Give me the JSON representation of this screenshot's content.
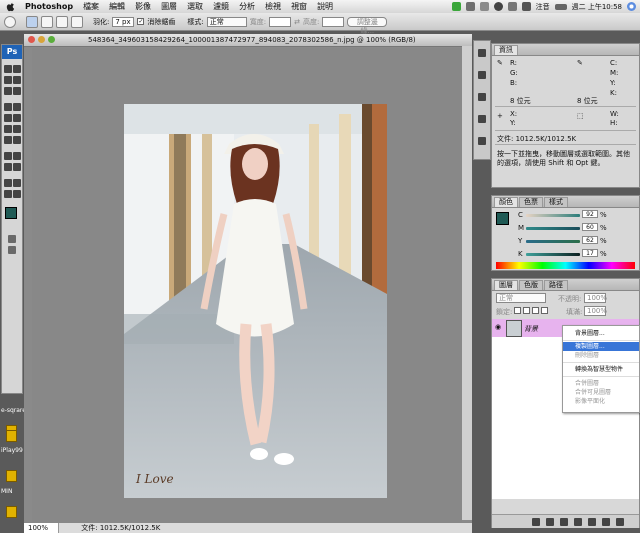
{
  "menubar": {
    "app_name": "Photoshop",
    "items": [
      "檔案",
      "編輯",
      "影像",
      "圖層",
      "選取",
      "濾鏡",
      "分析",
      "檢視",
      "視窗",
      "說明"
    ],
    "input_method": "注音",
    "clock": "週二 上午10:58"
  },
  "options_bar": {
    "feather_label": "羽化:",
    "feather_value": "7 px",
    "antialias_label": "消除鋸齒",
    "style_label": "樣式:",
    "style_value": "正常",
    "width_label": "寬度:",
    "height_label": "高度:",
    "refine_label": "調整邊緣..."
  },
  "toolbox": {
    "logo": "Ps"
  },
  "document": {
    "title": "548364_349603158429264_100001387472977_894083_2078302586_n.jpg @ 100% (RGB/8)",
    "zoom": "100%",
    "file_info": "文件: 1012.5K/1012.5K",
    "signature": "I Love"
  },
  "info_panel": {
    "tabs": [
      "資訊"
    ],
    "r": "R:",
    "g": "G:",
    "b": "B:",
    "c": "C:",
    "m": "M:",
    "y": "Y:",
    "k": "K:",
    "bit_left": "8 位元",
    "bit_right": "8 位元",
    "x": "X:",
    "y2": "Y:",
    "w": "W:",
    "h": "H:",
    "file_info": "文件: 1012.5K/1012.5K",
    "hint": "按一下並拖曳，移動圖層或選取範圍。其他的選項，請使用 Shift 和 Opt 鍵。"
  },
  "color_panel": {
    "tabs": [
      "顏色",
      "色票",
      "樣式"
    ],
    "channels": [
      {
        "label": "C",
        "value": "92",
        "unit": "%"
      },
      {
        "label": "M",
        "value": "60",
        "unit": "%"
      },
      {
        "label": "Y",
        "value": "62",
        "unit": "%"
      },
      {
        "label": "K",
        "value": "17",
        "unit": "%"
      }
    ]
  },
  "layers_panel": {
    "tabs": [
      "圖層",
      "色版",
      "路徑"
    ],
    "blend_mode": "正常",
    "opacity_label": "不透明:",
    "opacity_value": "100%",
    "lock_label": "鎖定:",
    "fill_label": "填滿:",
    "fill_value": "100%",
    "layer_name": "背景"
  },
  "context_menu": {
    "items": [
      {
        "label": "背景圖層...",
        "state": "normal"
      },
      {
        "label": "複製圖層...",
        "state": "highlight"
      },
      {
        "label": "刪除圖層",
        "state": "disabled"
      },
      {
        "label": "轉換為智慧型物件",
        "state": "normal"
      },
      {
        "label": "合併圖層",
        "state": "disabled"
      },
      {
        "label": "合併可見圖層",
        "state": "disabled"
      },
      {
        "label": "影像平面化",
        "state": "disabled"
      }
    ]
  },
  "desktop": {
    "labels": [
      "e-sqrare",
      "iPlay99",
      "MIN"
    ]
  },
  "colors": {
    "foreground": "#1f5a55",
    "layer_highlight": "#e7b3ee",
    "menu_highlight": "#3875d7",
    "ps_blue": "#1f63b6"
  }
}
